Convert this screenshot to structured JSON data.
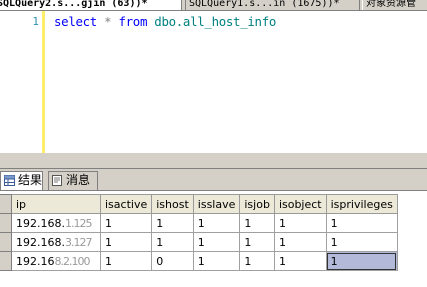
{
  "tabs": [
    {
      "label": "SQLQuery2.s...gjin (63))*",
      "active": true
    },
    {
      "label": "SQLQuery1.s...in (1675))*",
      "active": false
    },
    {
      "label": "对象资源管",
      "active": false
    }
  ],
  "editor": {
    "line_number": "1",
    "code": {
      "kw1": "select",
      "star": "*",
      "kw2": "from",
      "object": "dbo.all_host_info"
    }
  },
  "result_tabs": [
    {
      "label": "结果",
      "icon": "grid-icon"
    },
    {
      "label": "消息",
      "icon": "message-icon"
    }
  ],
  "grid": {
    "columns": [
      "ip",
      "isactive",
      "ishost",
      "isslave",
      "isjob",
      "isobject",
      "isprivileges"
    ],
    "rows": [
      {
        "ip_visible": "192.168.",
        "ip_obscured": "1.125",
        "values": [
          "1",
          "1",
          "1",
          "1",
          "1",
          "1"
        ]
      },
      {
        "ip_visible": "192.168.",
        "ip_obscured": "3.127",
        "values": [
          "1",
          "1",
          "1",
          "1",
          "1",
          "1"
        ]
      },
      {
        "ip_visible": "192.16",
        "ip_obscured": "8.2.100",
        "values": [
          "1",
          "0",
          "1",
          "1",
          "1",
          "1"
        ]
      }
    ],
    "selected_cell": {
      "row": 3,
      "column": "isprivileges"
    }
  },
  "colors": {
    "keyword": "#0000ff",
    "object_name": "#008080",
    "selection": "#b3b9d9",
    "chrome": "#d4d0c8"
  }
}
